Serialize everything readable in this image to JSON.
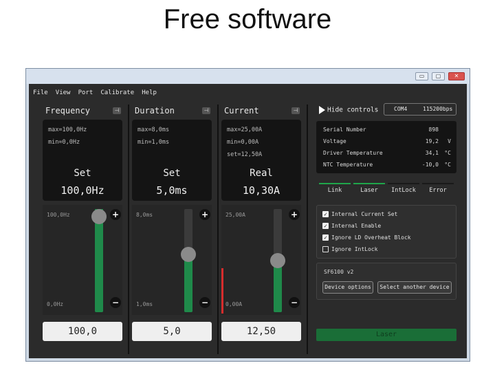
{
  "slide": {
    "title": "Free software"
  },
  "window": {
    "controls": {
      "minimize": "▭",
      "maximize": "▢",
      "close": "✕"
    }
  },
  "menu": [
    "File",
    "View",
    "Port",
    "Calibrate",
    "Help"
  ],
  "panels": [
    {
      "title": "Frequency",
      "info": [
        "max=100,0Hz",
        "min=0,0Hz"
      ],
      "mode_label": "Set",
      "display_value": "100,0Hz",
      "scale_max": "100,0Hz",
      "scale_min": "0,0Hz",
      "slider_fraction": 1.0,
      "input_value": "100,0"
    },
    {
      "title": "Duration",
      "info": [
        "max=8,0ms",
        "min=1,0ms"
      ],
      "mode_label": "Set",
      "display_value": "5,0ms",
      "scale_max": "8,0ms",
      "scale_min": "1,0ms",
      "slider_fraction": 0.57,
      "input_value": "5,0"
    },
    {
      "title": "Current",
      "info": [
        "max=25,00A",
        "min=0,00A",
        "set=12,50A"
      ],
      "mode_label": "Real",
      "display_value": "10,30A",
      "scale_max": "25,00A",
      "scale_min": "0,00A",
      "slider_fraction": 0.5,
      "input_value": "12,50"
    }
  ],
  "controls": {
    "hide_label": "Hide controls",
    "port": "COM4",
    "baud": "115200bps"
  },
  "status": [
    {
      "label": "Serial Number",
      "value": "898",
      "unit": ""
    },
    {
      "label": "Voltage",
      "value": "19,2",
      "unit": "V"
    },
    {
      "label": "Driver Temperature",
      "value": "34,1",
      "unit": "°C"
    },
    {
      "label": "NTC Temperature",
      "value": "-10,0",
      "unit": "°C"
    }
  ],
  "indicators": [
    {
      "label": "Link",
      "color": "#1fa64a"
    },
    {
      "label": "Laser",
      "color": "#1fa64a"
    },
    {
      "label": "IntLock",
      "color": "#1a1a1a"
    },
    {
      "label": "Error",
      "color": "#1a1a1a"
    }
  ],
  "options": [
    {
      "label": "Internal Current Set",
      "checked": true
    },
    {
      "label": "Internal Enable",
      "checked": true
    },
    {
      "label": "Ignore LD Overheat Block",
      "checked": true
    },
    {
      "label": "Ignore IntLock",
      "checked": false
    }
  ],
  "device": {
    "name": "SF6100 v2",
    "options_button": "Device options",
    "select_button": "Select another device"
  },
  "laser_button": "Laser",
  "colors": {
    "accent_green": "#1f8a4a",
    "alarm_red": "#d62c2c"
  }
}
